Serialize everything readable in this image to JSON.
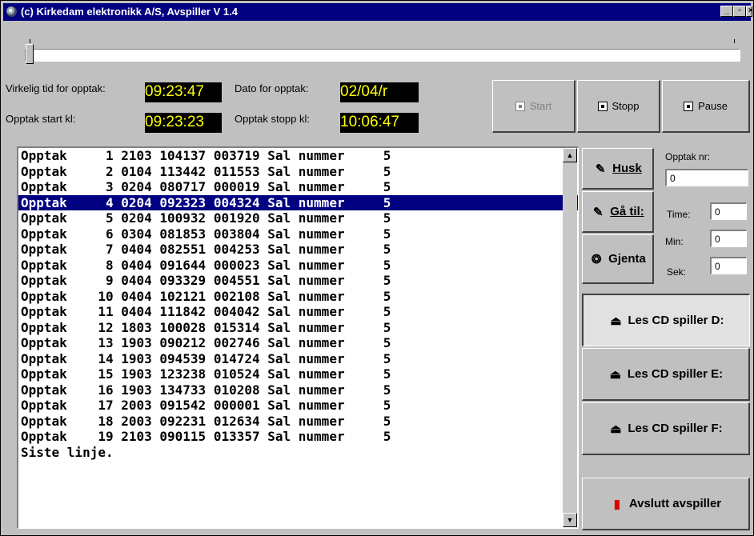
{
  "window": {
    "title": "(c) Kirkedam elektronikk A/S, Avspiller V 1.4",
    "controls": {
      "minimize": "_",
      "maximize": "▫",
      "close": "×"
    }
  },
  "position_slider": {
    "value_fraction": 0.0
  },
  "info": {
    "actual_time_label": "Virkelig tid for opptak:",
    "actual_time_value": "09:23:47",
    "date_label": "Dato for opptak:",
    "date_value": "02/04/r",
    "start_label": "Opptak start kl:",
    "start_value": "09:23:23",
    "stop_label": "Opptak stopp kl:",
    "stop_value": "10:06:47"
  },
  "transport": {
    "start": "Start",
    "stop": "Stopp",
    "pause": "Pause"
  },
  "recordings": [
    "Opptak     1 2103 104137 003719 Sal nummer     5",
    "Opptak     2 0104 113442 011553 Sal nummer     5",
    "Opptak     3 0204 080717 000019 Sal nummer     5",
    "Opptak     4 0204 092323 004324 Sal nummer     5",
    "Opptak     5 0204 100932 001920 Sal nummer     5",
    "Opptak     6 0304 081853 003804 Sal nummer     5",
    "Opptak     7 0404 082551 004253 Sal nummer     5",
    "Opptak     8 0404 091644 000023 Sal nummer     5",
    "Opptak     9 0404 093329 004551 Sal nummer     5",
    "Opptak    10 0404 102121 002108 Sal nummer     5",
    "Opptak    11 0404 111842 004042 Sal nummer     5",
    "Opptak    12 1803 100028 015314 Sal nummer     5",
    "Opptak    13 1903 090212 002746 Sal nummer     5",
    "Opptak    14 1903 094539 014724 Sal nummer     5",
    "Opptak    15 1903 123238 010524 Sal nummer     5",
    "Opptak    16 1903 134733 010208 Sal nummer     5",
    "Opptak    17 2003 091542 000001 Sal nummer     5",
    "Opptak    18 2003 092231 012634 Sal nummer     5",
    "Opptak    19 2103 090115 013357 Sal nummer     5",
    "Siste linje."
  ],
  "selected_index": 3,
  "side": {
    "husk": "Husk",
    "gatil": "Gå til:",
    "gjenta": "Gjenta",
    "opptak_nr_label": "Opptak nr:",
    "opptak_nr_value": "0",
    "time_label": "Time:",
    "time_value": "0",
    "min_label": "Min:",
    "min_value": "0",
    "sek_label": "Sek:",
    "sek_value": "0"
  },
  "cd": {
    "d": "Les CD spiller D:",
    "e": "Les CD spiller E:",
    "f": "Les CD spiller F:"
  },
  "quit": "Avslutt avspiller"
}
